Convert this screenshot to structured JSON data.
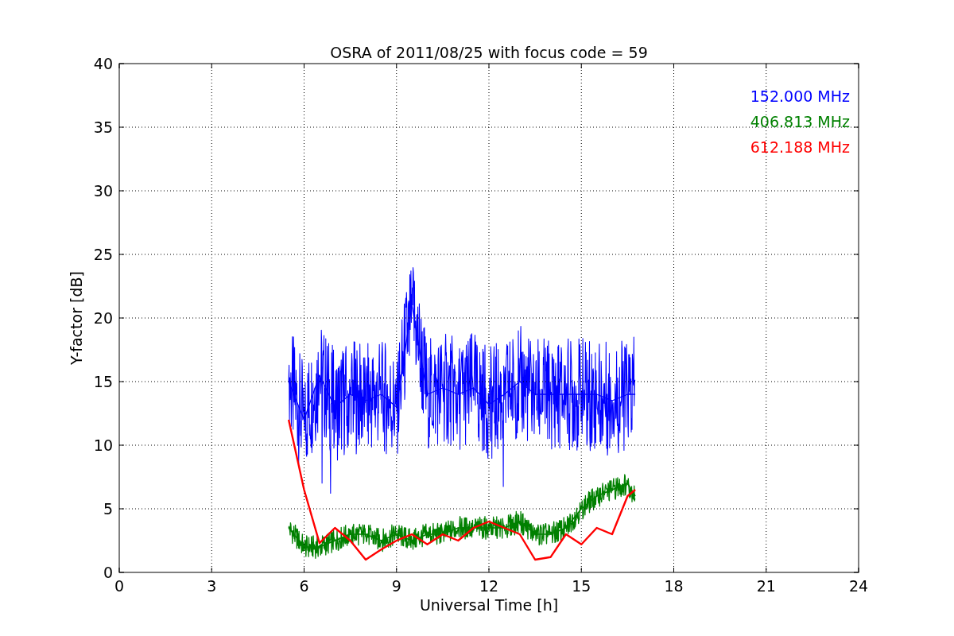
{
  "figure": {
    "chart_data": {
      "type": "line",
      "title": "OSRA of 2011/08/25 with focus code = 59",
      "xlabel": "Universal Time [h]",
      "ylabel": "Y-factor [dB]",
      "xlim": [
        0,
        24
      ],
      "ylim": [
        0,
        40
      ],
      "xticks": [
        0,
        3,
        6,
        9,
        12,
        15,
        18,
        21,
        24
      ],
      "yticks": [
        0,
        5,
        10,
        15,
        20,
        25,
        30,
        35,
        40
      ],
      "grid": true,
      "x": [
        5.5,
        6,
        6.5,
        7,
        7.5,
        8,
        8.5,
        9,
        9.5,
        10,
        10.5,
        11,
        11.5,
        12,
        12.5,
        13,
        13.5,
        14,
        14.5,
        15,
        15.5,
        16,
        16.5,
        16.75
      ],
      "series": [
        {
          "name": "152.000 MHz",
          "color": "#0000ff",
          "values": [
            15,
            12,
            15.5,
            13,
            14,
            13.5,
            14,
            13,
            21,
            14,
            14.5,
            14,
            14.5,
            13.2,
            14,
            15,
            14,
            14,
            14,
            14,
            14,
            13.5,
            14,
            14
          ]
        },
        {
          "name": "406.813 MHz",
          "color": "#008000",
          "values": [
            3.5,
            2,
            2,
            2.5,
            3,
            3,
            2.5,
            3,
            2.5,
            3,
            3,
            3.5,
            3.5,
            3.5,
            3.5,
            4,
            3,
            3,
            3.5,
            5,
            6,
            6.5,
            7,
            6
          ]
        },
        {
          "name": "612.188 MHz",
          "color": "#ff0000",
          "values": [
            12,
            6.5,
            2.3,
            3.5,
            2.5,
            1,
            1.8,
            2.5,
            3,
            2.2,
            3,
            2.5,
            3.5,
            4,
            3.5,
            3,
            1,
            1.2,
            3,
            2.2,
            3.5,
            3,
            6,
            6.5
          ]
        }
      ]
    }
  }
}
